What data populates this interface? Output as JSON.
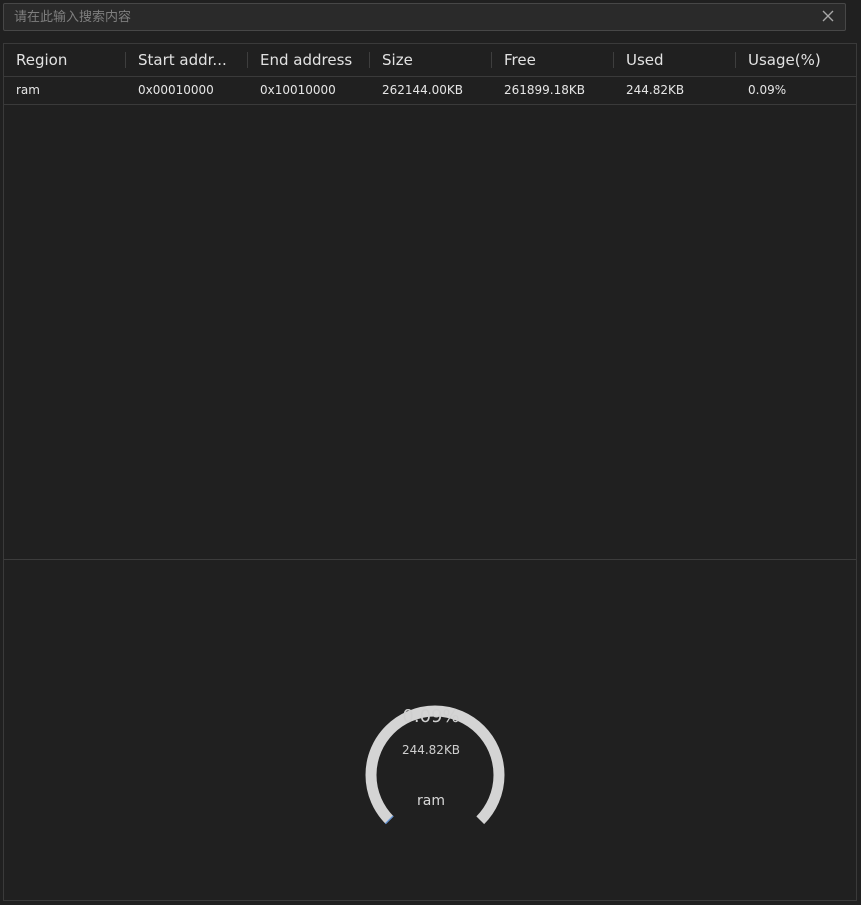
{
  "search": {
    "placeholder": "请在此输入搜索内容",
    "value": "",
    "clear_icon": "close-icon"
  },
  "table": {
    "columns": [
      "Region",
      "Start addr...",
      "End address",
      "Size",
      "Free",
      "Used",
      "Usage(%)"
    ],
    "rows": [
      [
        "ram",
        "0x00010000",
        "0x10010000",
        "262144.00KB",
        "261899.18KB",
        "244.82KB",
        "0.09%"
      ]
    ]
  },
  "gauge": {
    "percent_label": "0.09%",
    "used_label": "244.82KB",
    "name": "ram",
    "value_percent": 0.09,
    "track_color": "#d4d4d4",
    "fill_color": "#5b8fd6"
  }
}
